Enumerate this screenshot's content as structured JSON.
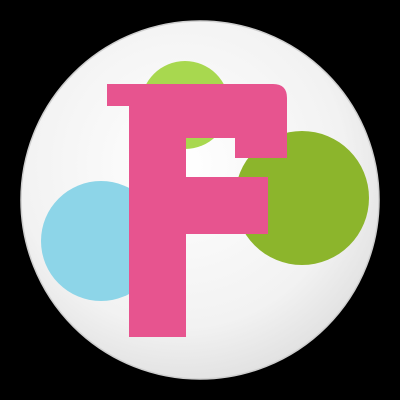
{
  "app_icon": {
    "letter": "F",
    "icon_name": "letter-f-app-icon",
    "colors": {
      "background": "#000000",
      "disc": "#f2f2f2",
      "disc_edge": "#d9d9d9",
      "letter": "#e7548f",
      "bubble_light_green": "#a8d84f",
      "bubble_dark_green": "#8cb52c",
      "bubble_blue": "#8dd5e8"
    }
  }
}
